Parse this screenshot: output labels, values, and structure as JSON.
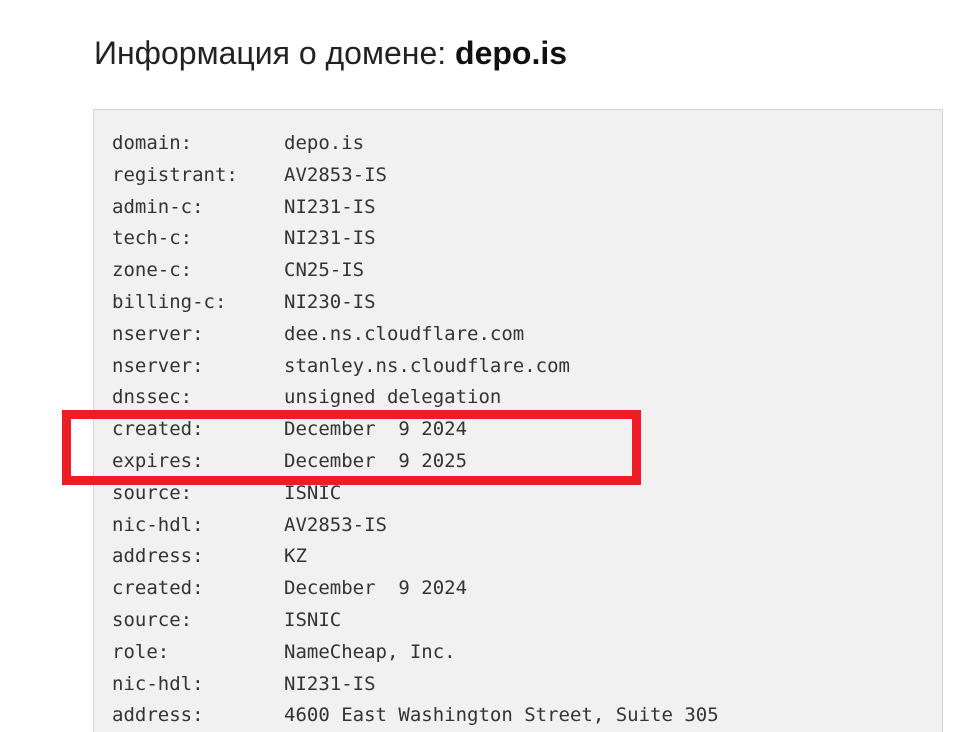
{
  "header": {
    "title_prefix": "Информация о домене: ",
    "title_domain": "depo.is"
  },
  "whois": [
    {
      "key": "domain:",
      "value": "depo.is"
    },
    {
      "key": "registrant:",
      "value": "AV2853-IS"
    },
    {
      "key": "admin-c:",
      "value": "NI231-IS"
    },
    {
      "key": "tech-c:",
      "value": "NI231-IS"
    },
    {
      "key": "zone-c:",
      "value": "CN25-IS"
    },
    {
      "key": "billing-c:",
      "value": "NI230-IS"
    },
    {
      "key": "nserver:",
      "value": "dee.ns.cloudflare.com"
    },
    {
      "key": "nserver:",
      "value": "stanley.ns.cloudflare.com"
    },
    {
      "key": "dnssec:",
      "value": "unsigned delegation"
    },
    {
      "key": "created:",
      "value": "December  9 2024"
    },
    {
      "key": "expires:",
      "value": "December  9 2025"
    },
    {
      "key": "source:",
      "value": "ISNIC"
    },
    {
      "key": "nic-hdl:",
      "value": "AV2853-IS"
    },
    {
      "key": "address:",
      "value": "KZ"
    },
    {
      "key": "created:",
      "value": "December  9 2024"
    },
    {
      "key": "source:",
      "value": "ISNIC"
    },
    {
      "key": "role:",
      "value": "NameCheap, Inc."
    },
    {
      "key": "nic-hdl:",
      "value": "NI231-IS"
    },
    {
      "key": "address:",
      "value": "4600 East Washington Street, Suite 305"
    }
  ],
  "colors": {
    "highlight": "#ee1c24",
    "box_background": "#f1f1f1"
  }
}
